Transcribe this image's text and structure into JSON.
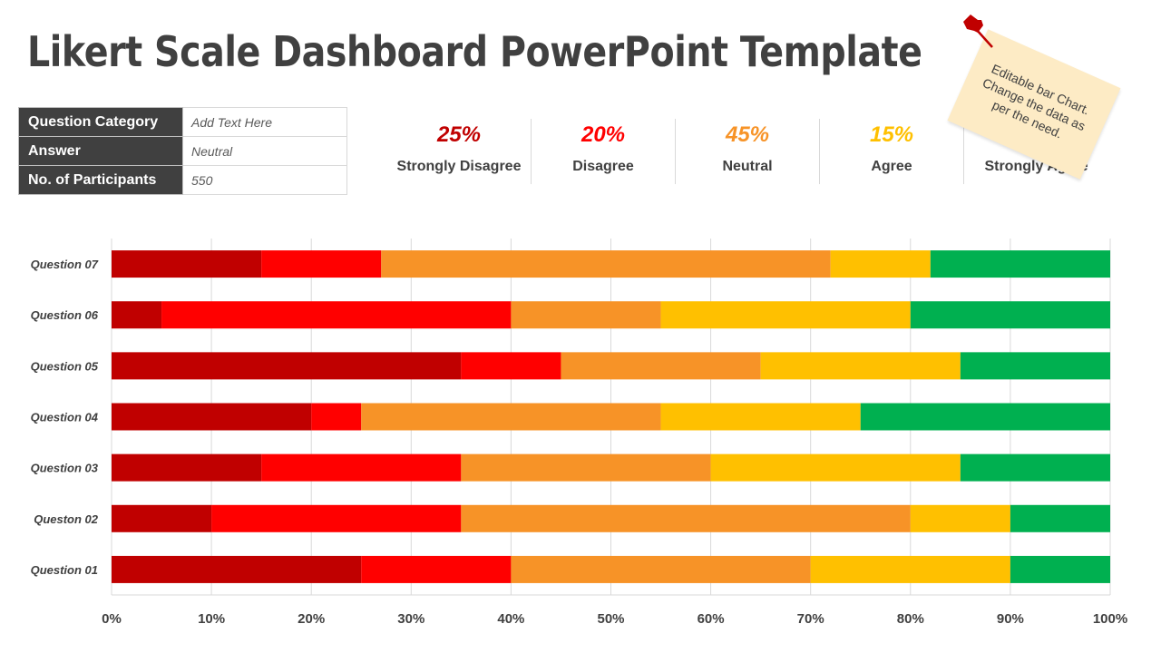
{
  "title": "Likert Scale Dashboard PowerPoint Template",
  "info_table": [
    {
      "key": "Question Category",
      "value": "Add Text Here"
    },
    {
      "key": "Answer",
      "value": "Neutral"
    },
    {
      "key": "No. of Participants",
      "value": "550"
    }
  ],
  "summary": [
    {
      "percent": "25%",
      "label": "Strongly Disagree",
      "color": "#c00000"
    },
    {
      "percent": "20%",
      "label": "Disagree",
      "color": "#ff0000"
    },
    {
      "percent": "45%",
      "label": "Neutral",
      "color": "#f79327"
    },
    {
      "percent": "15%",
      "label": "Agree",
      "color": "#ffc000"
    },
    {
      "percent": "",
      "label": "Strongly Agree",
      "color": "#00b050"
    }
  ],
  "sticky_note": {
    "text": "Editable bar Chart. Change the data as per the need.",
    "icon": "pushpin-icon"
  },
  "chart_data": {
    "type": "bar",
    "orientation": "horizontal",
    "stacked": "percent",
    "title": "",
    "xlabel": "",
    "ylabel": "",
    "xlim": [
      0,
      100
    ],
    "x_ticks": [
      "0%",
      "10%",
      "20%",
      "30%",
      "40%",
      "50%",
      "60%",
      "70%",
      "80%",
      "90%",
      "100%"
    ],
    "grid": true,
    "legend": "none",
    "categories": [
      "Question 07",
      "Question 06",
      "Question 05",
      "Question 04",
      "Question 03",
      "Queston 02",
      "Question 01"
    ],
    "series": [
      {
        "name": "Strongly Disagree",
        "color": "#c00000",
        "values": [
          15,
          5,
          35,
          20,
          15,
          10,
          25
        ]
      },
      {
        "name": "Disagree",
        "color": "#ff0000",
        "values": [
          12,
          35,
          10,
          5,
          20,
          25,
          15
        ]
      },
      {
        "name": "Neutral",
        "color": "#f79327",
        "values": [
          45,
          15,
          20,
          30,
          25,
          45,
          30
        ]
      },
      {
        "name": "Agree",
        "color": "#ffc000",
        "values": [
          10,
          25,
          20,
          20,
          25,
          10,
          20
        ]
      },
      {
        "name": "Strongly Agree",
        "color": "#00b050",
        "values": [
          18,
          20,
          15,
          25,
          15,
          10,
          10
        ]
      }
    ]
  }
}
